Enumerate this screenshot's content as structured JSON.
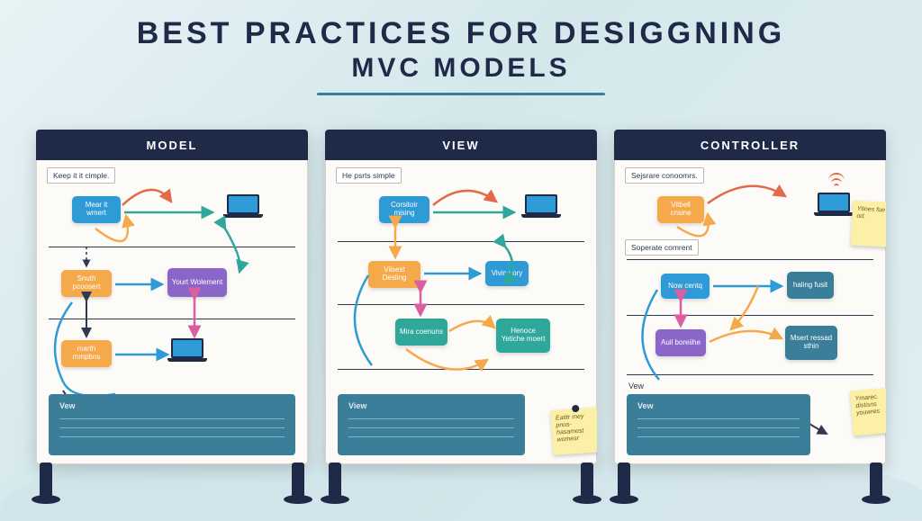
{
  "title_line1": "BEST PRACTICES FOR DESIGGNING",
  "title_line2": "MVC MODELS",
  "boards": [
    {
      "header": "MODEL",
      "tag_main": "Keep it it cimple.",
      "chip_top": "Mear it wmert",
      "chip_mid_left": "Snuth pcoosert",
      "chip_mid_right": "Yourt Wolement",
      "chip_bottom": "marth mmpbns",
      "view_label": "Vew"
    },
    {
      "header": "VIEW",
      "tag_main": "He psrts simple",
      "chip_top": "Corsitoir mising",
      "chip_mid_left": "Vilsest Desling",
      "chip_mid_right": "Vivin vory",
      "chip_low_left": "Mira coenuns",
      "chip_low_right": "Henoce Yetiche moert",
      "view_label": "View",
      "sticky": "Eatitr mey pnos- hasamest womesr"
    },
    {
      "header": "CONTROLLER",
      "tag_main": "Sejsrare conoomrs.",
      "tag_secondary": "Soperate comrent",
      "chip_top": "Vitbell cnsine",
      "chip_mid_left": "Now centq",
      "chip_mid_right": "haling fusit",
      "chip_low_left": "Auil boreiihe",
      "chip_low_right": "Msert ressad sthin",
      "view_label": "Vew",
      "sticky_top": "Ytines fue off-od.",
      "sticky_bottom": "Ymarec. distisns youwres"
    }
  ]
}
